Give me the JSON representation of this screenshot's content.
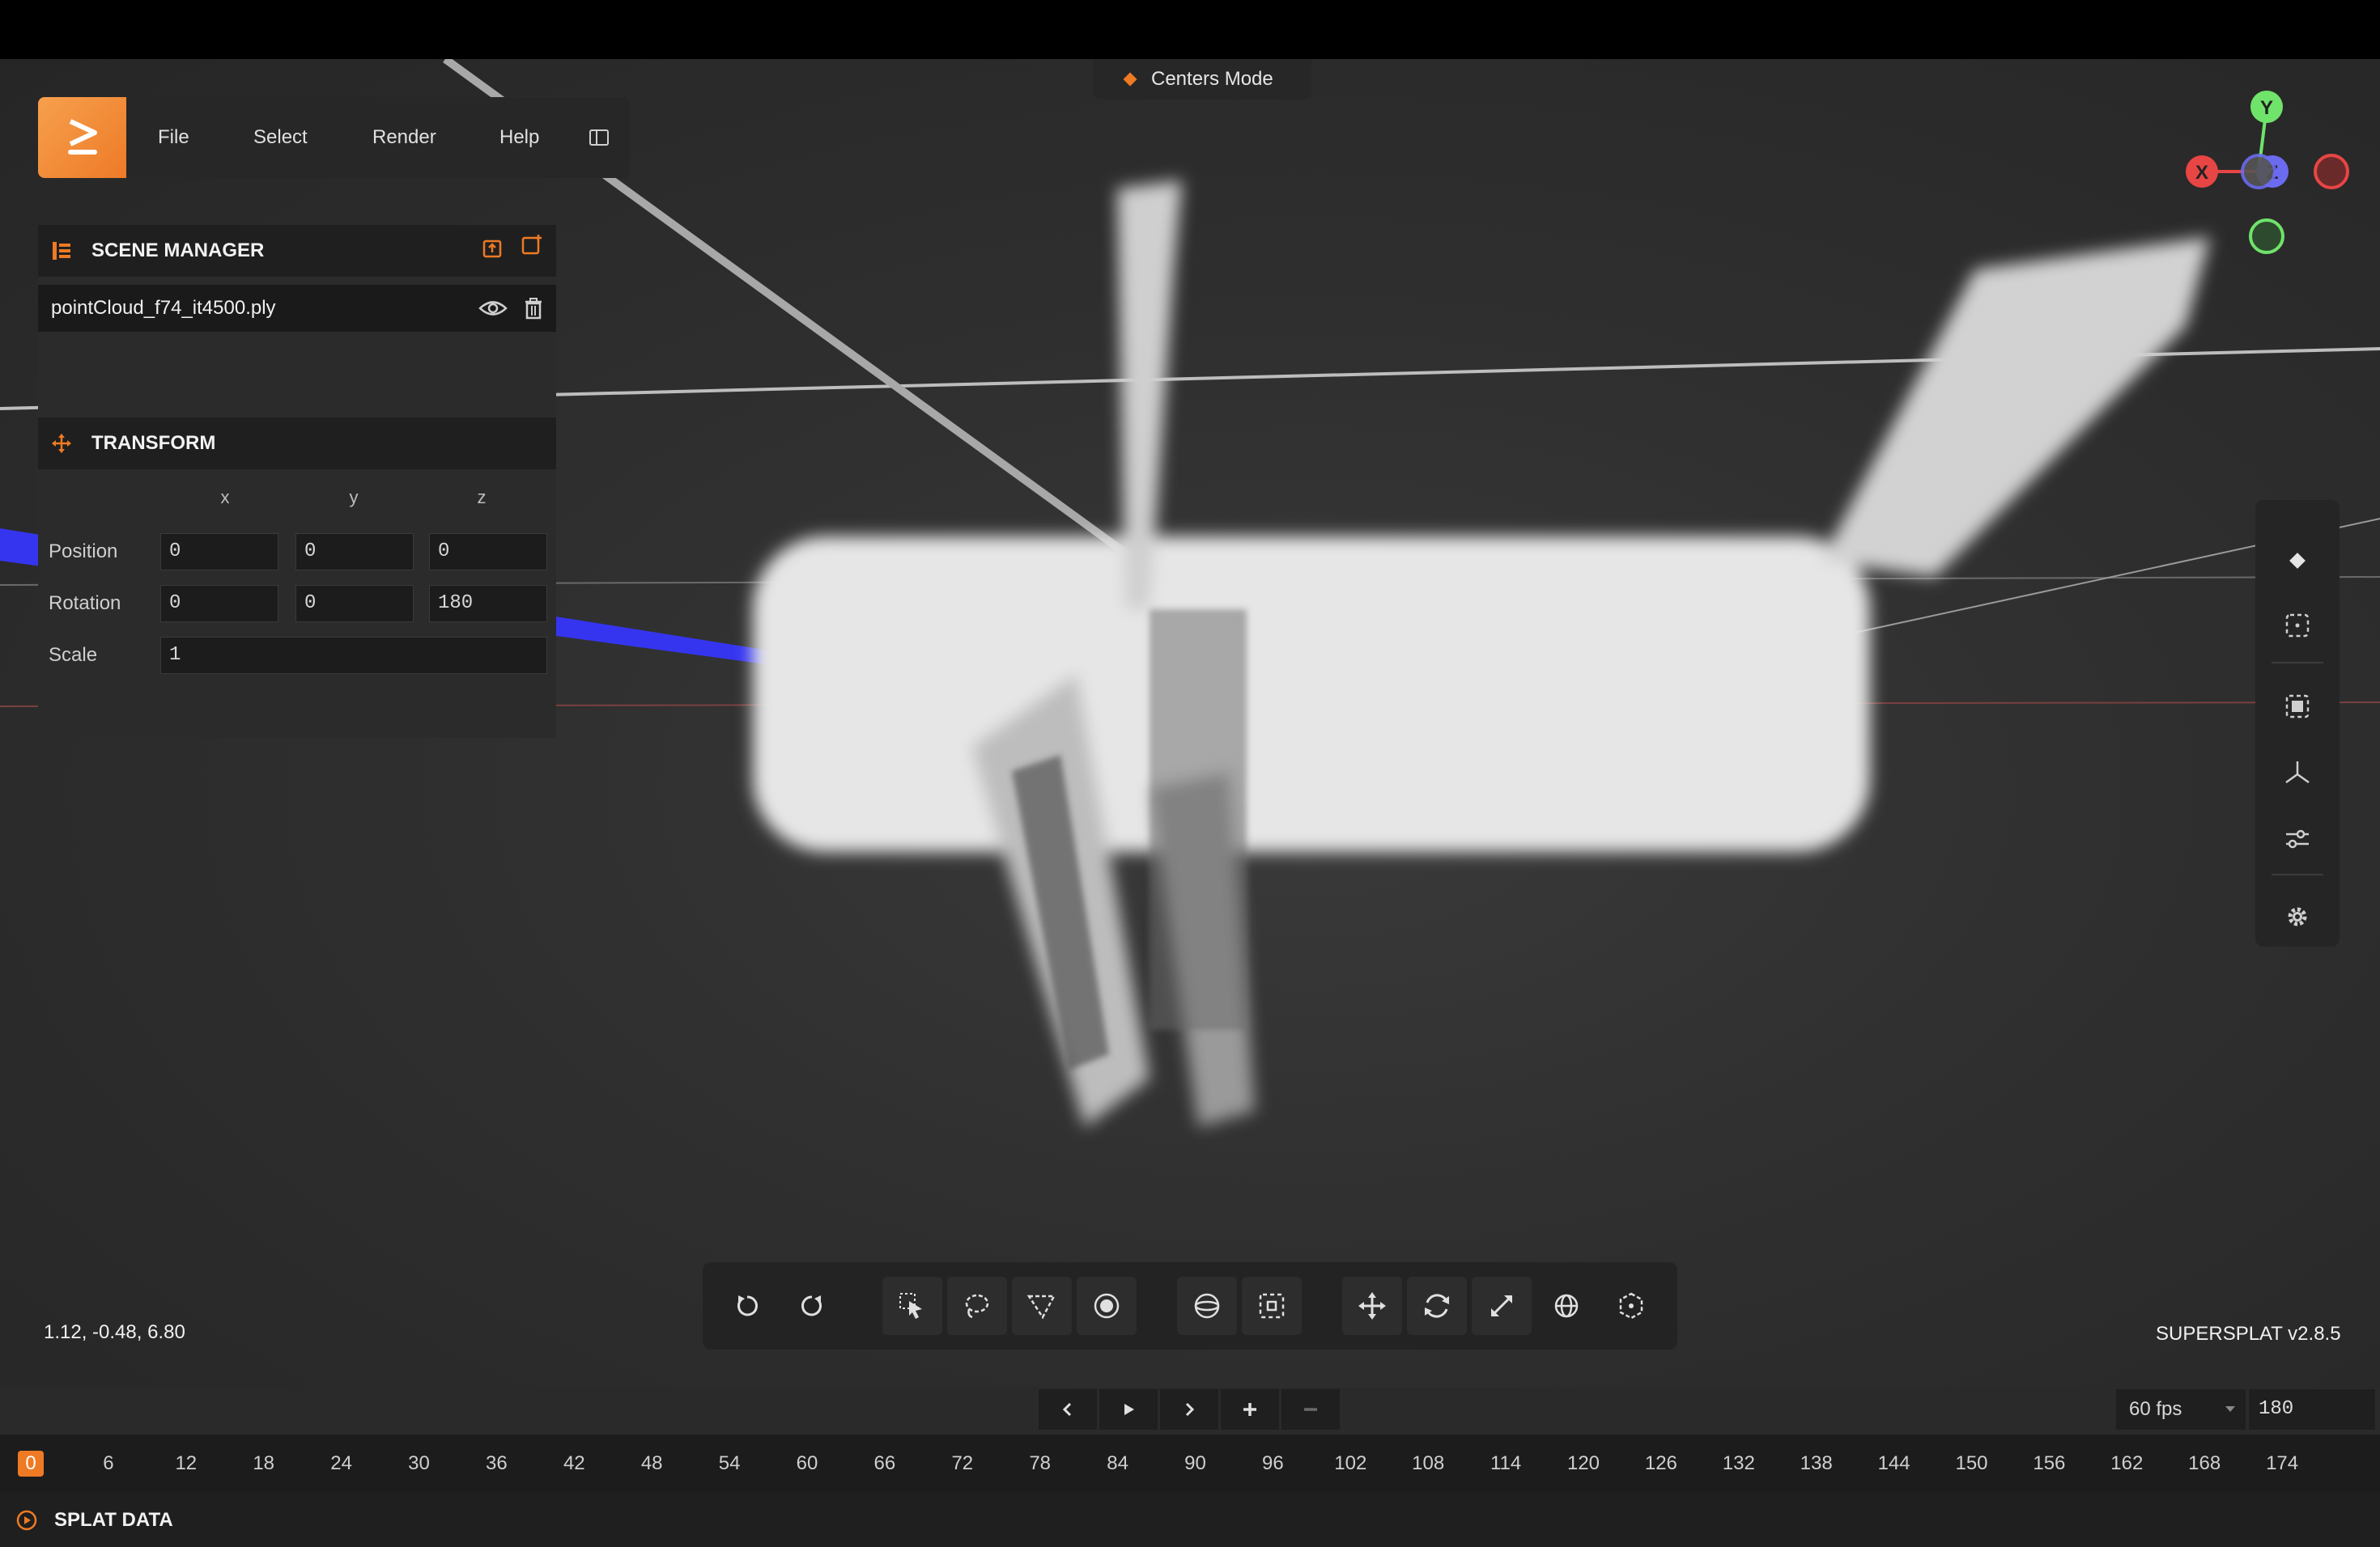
{
  "menu": {
    "items": [
      "File",
      "Select",
      "Render",
      "Help"
    ]
  },
  "mode_indicator": "Centers Mode",
  "scene_manager": {
    "title": "SCENE MANAGER",
    "files": [
      {
        "name": "pointCloud_f74_it4500.ply"
      }
    ]
  },
  "transform": {
    "title": "TRANSFORM",
    "axes": [
      "x",
      "y",
      "z"
    ],
    "position_label": "Position",
    "position": [
      "0",
      "0",
      "0"
    ],
    "rotation_label": "Rotation",
    "rotation": [
      "0",
      "0",
      "180"
    ],
    "scale_label": "Scale",
    "scale": "1"
  },
  "gizmo": {
    "x_label": "X",
    "y_label": "Y",
    "z_label": "Z"
  },
  "status": {
    "camera_coords": "1.12, -0.48, 6.80",
    "version": "SUPERSPLAT v2.8.5"
  },
  "timeline": {
    "fps": "60 fps",
    "frames": "180",
    "current_frame": "0",
    "ticks": [
      "0",
      "6",
      "12",
      "18",
      "24",
      "30",
      "36",
      "42",
      "48",
      "54",
      "60",
      "66",
      "72",
      "78",
      "84",
      "90",
      "96",
      "102",
      "108",
      "114",
      "120",
      "126",
      "132",
      "138",
      "144",
      "150",
      "156",
      "162",
      "168",
      "174"
    ]
  },
  "bottom_panel": {
    "title": "SPLAT DATA"
  },
  "colors": {
    "accent": "#ef7a24",
    "axis_x": "#e84545",
    "axis_y": "#6fe36a",
    "axis_z": "#6b6bf0"
  }
}
